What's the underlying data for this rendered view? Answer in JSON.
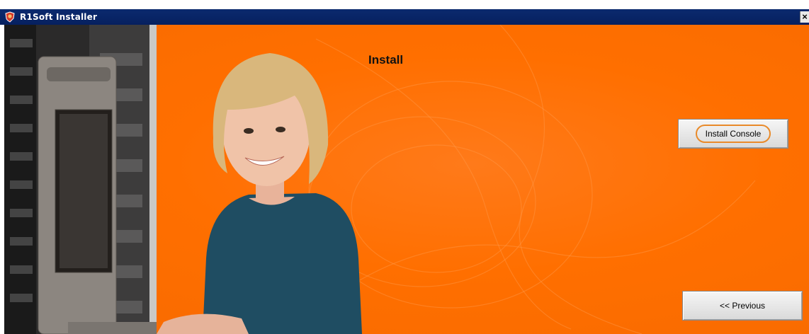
{
  "window": {
    "title": "R1Soft Installer",
    "close_glyph": "×"
  },
  "main": {
    "heading": "Install"
  },
  "buttons": {
    "install_console": "Install Console",
    "previous": "<< Previous"
  },
  "colors": {
    "titlebar": "#06205f",
    "background": "#ff6f00",
    "focus_ring": "#e98a2a"
  },
  "icons": {
    "app": "r1soft-shield-icon",
    "close": "close-icon"
  }
}
